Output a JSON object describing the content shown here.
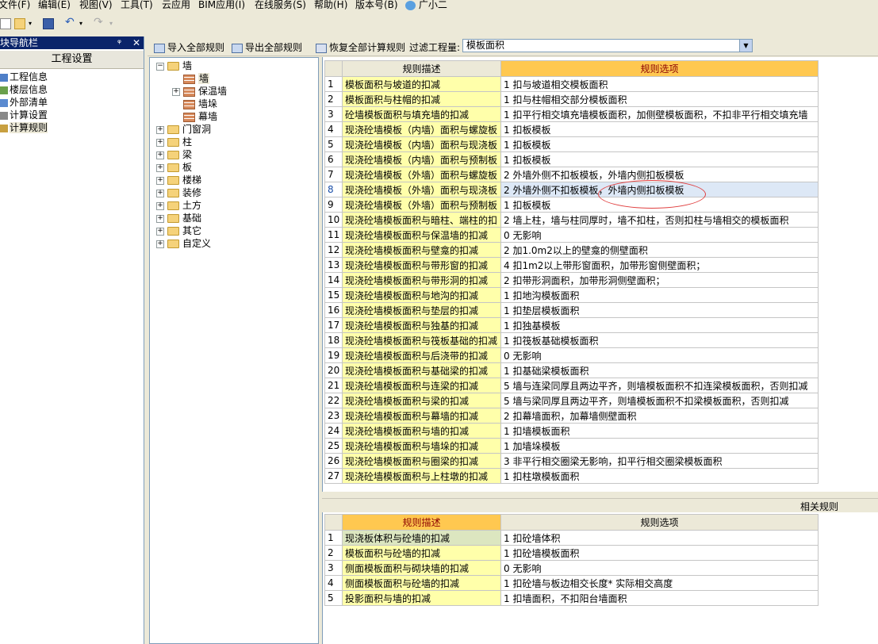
{
  "menu": [
    "文件(F)",
    "编辑(E)",
    "视图(V)",
    "工具(T)",
    "云应用",
    "BIM应用(I)",
    "在线服务(S)",
    "帮助(H)",
    "版本号(B)",
    "广小二"
  ],
  "nav": {
    "title": "模块导航栏",
    "section": "工程设置",
    "items": [
      "工程信息",
      "楼层信息",
      "外部清单",
      "计算设置",
      "计算规则"
    ]
  },
  "toolbar": {
    "import_all": "导入全部规则",
    "export_all": "导出全部规则",
    "restore_all": "恢复全部计算规则",
    "filter_label": "过滤工程量:",
    "filter_value": "模板面积"
  },
  "tree": {
    "root": "墙",
    "children": [
      "墙",
      "保温墙",
      "墙垛",
      "幕墙"
    ],
    "others": [
      "门窗洞",
      "柱",
      "梁",
      "板",
      "楼梯",
      "装修",
      "土方",
      "基础",
      "其它",
      "自定义"
    ]
  },
  "grid": {
    "col_desc": "规则描述",
    "col_opt": "规则选项",
    "rows": [
      {
        "n": "1",
        "desc": "模板面积与坡道的扣减",
        "opt": "1 扣与坡道相交模板面积"
      },
      {
        "n": "2",
        "desc": "模板面积与柱帽的扣减",
        "opt": "1 扣与柱帽相交部分模板面积"
      },
      {
        "n": "3",
        "desc": "砼墙模板面积与填充墙的扣减",
        "opt": "1 扣平行相交填充墙模板面积，加侧壁模板面积，不扣非平行相交填充墙"
      },
      {
        "n": "4",
        "desc": "现浇砼墙模板（内墙）面积与螺旋板",
        "opt": "1  扣板模板"
      },
      {
        "n": "5",
        "desc": "现浇砼墙模板（内墙）面积与现浇板",
        "opt": "1  扣板模板"
      },
      {
        "n": "6",
        "desc": "现浇砼墙模板（内墙）面积与预制板",
        "opt": "1  扣板模板"
      },
      {
        "n": "7",
        "desc": "现浇砼墙模板（外墙）面积与螺旋板",
        "opt": "2  外墙外侧不扣板模板，外墙内侧扣板模板"
      },
      {
        "n": "8",
        "desc": "现浇砼墙模板（外墙）面积与现浇板",
        "opt": "2  外墙外侧不扣板模板，外墙内侧扣板模板"
      },
      {
        "n": "9",
        "desc": "现浇砼墙模板（外墙）面积与预制板",
        "opt": "1  扣板模板"
      },
      {
        "n": "10",
        "desc": "现浇砼墙模板面积与暗柱、端柱的扣",
        "opt": "2  墙上柱，墙与柱同厚时，墙不扣柱，否则扣柱与墙相交的模板面积"
      },
      {
        "n": "11",
        "desc": "现浇砼墙模板面积与保温墙的扣减",
        "opt": "0  无影响"
      },
      {
        "n": "12",
        "desc": "现浇砼墙模板面积与壁龛的扣减",
        "opt": "2  加1.0m2以上的壁龛的侧壁面积"
      },
      {
        "n": "13",
        "desc": "现浇砼墙模板面积与带形窗的扣减",
        "opt": "4  扣1m2以上带形窗面积，加带形窗侧壁面积；"
      },
      {
        "n": "14",
        "desc": "现浇砼墙模板面积与带形洞的扣减",
        "opt": "2  扣带形洞面积，加带形洞侧壁面积；"
      },
      {
        "n": "15",
        "desc": "现浇砼墙模板面积与地沟的扣减",
        "opt": "1  扣地沟模板面积"
      },
      {
        "n": "16",
        "desc": "现浇砼墙模板面积与垫层的扣减",
        "opt": "1  扣垫层模板面积"
      },
      {
        "n": "17",
        "desc": "现浇砼墙模板面积与独基的扣减",
        "opt": "1  扣独基模板"
      },
      {
        "n": "18",
        "desc": "现浇砼墙模板面积与筏板基础的扣减",
        "opt": "1  扣筏板基础模板面积"
      },
      {
        "n": "19",
        "desc": "现浇砼墙模板面积与后浇带的扣减",
        "opt": "0  无影响"
      },
      {
        "n": "20",
        "desc": "现浇砼墙模板面积与基础梁的扣减",
        "opt": "1  扣基础梁模板面积"
      },
      {
        "n": "21",
        "desc": "现浇砼墙模板面积与连梁的扣减",
        "opt": "5 墙与连梁同厚且两边平齐，则墙模板面积不扣连梁模板面积，否则扣减"
      },
      {
        "n": "22",
        "desc": "现浇砼墙模板面积与梁的扣减",
        "opt": "5  墙与梁同厚且两边平齐，则墙模板面积不扣梁模板面积，否则扣减"
      },
      {
        "n": "23",
        "desc": "现浇砼墙模板面积与幕墙的扣减",
        "opt": "2 扣幕墙面积，加幕墙侧壁面积"
      },
      {
        "n": "24",
        "desc": "现浇砼墙模板面积与墙的扣减",
        "opt": "1  扣墙模板面积"
      },
      {
        "n": "25",
        "desc": "现浇砼墙模板面积与墙垛的扣减",
        "opt": "1  加墙垛模板"
      },
      {
        "n": "26",
        "desc": "现浇砼墙模板面积与圈梁的扣减",
        "opt": "3  非平行相交圈梁无影响，扣平行相交圈梁模板面积"
      },
      {
        "n": "27",
        "desc": "现浇砼墙模板面积与上柱墩的扣减",
        "opt": "1  扣柱墩模板面积"
      }
    ]
  },
  "related": {
    "title": "相关规则",
    "col_desc": "规则描述",
    "col_opt": "规则选项",
    "rows": [
      {
        "n": "1",
        "desc": "现浇板体积与砼墙的扣减",
        "opt": "1  扣砼墙体积"
      },
      {
        "n": "2",
        "desc": "模板面积与砼墙的扣减",
        "opt": "1  扣砼墙模板面积"
      },
      {
        "n": "3",
        "desc": "侧面模板面积与砌块墙的扣减",
        "opt": "0  无影响"
      },
      {
        "n": "4",
        "desc": "侧面模板面积与砼墙的扣减",
        "opt": "1  扣砼墙与板边相交长度* 实际相交高度"
      },
      {
        "n": "5",
        "desc": "投影面积与墙的扣减",
        "opt": "1  扣墙面积，不扣阳台墙面积"
      }
    ]
  }
}
